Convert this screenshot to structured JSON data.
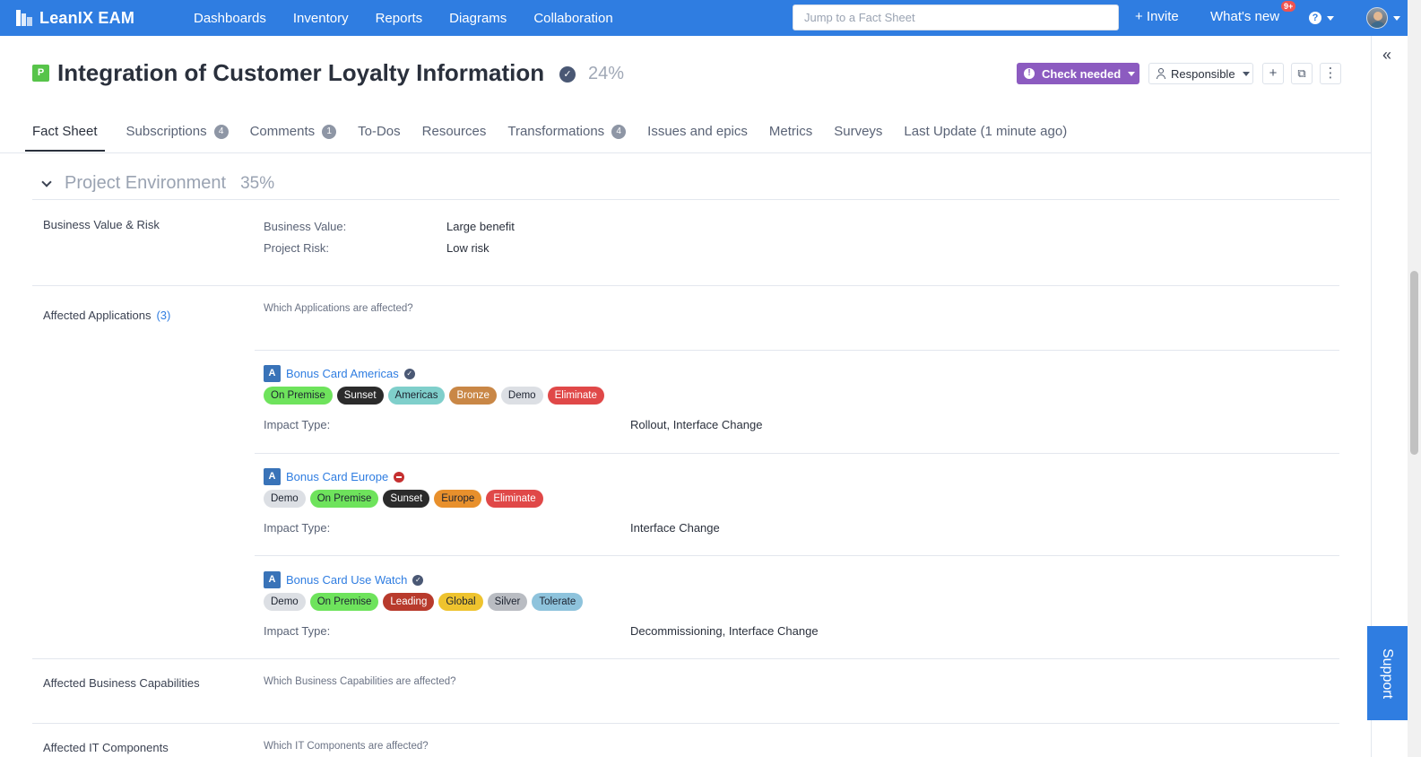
{
  "topbar": {
    "brand": "LeanIX EAM",
    "nav": [
      "Dashboards",
      "Inventory",
      "Reports",
      "Diagrams",
      "Collaboration"
    ],
    "search_placeholder": "Jump to a Fact Sheet",
    "invite": "+ Invite",
    "whats_new": "What's new",
    "whats_new_badge": "9+",
    "help": "?"
  },
  "header": {
    "type_letter": "P",
    "title": "Integration of Customer Loyalty Information",
    "completion": "24%",
    "check_needed": "Check needed",
    "responsible": "Responsible",
    "add": "+",
    "copy": "⧉",
    "more": "⋮"
  },
  "tabs": [
    {
      "label": "Fact Sheet",
      "count": ""
    },
    {
      "label": "Subscriptions",
      "count": "4"
    },
    {
      "label": "Comments",
      "count": "1"
    },
    {
      "label": "To-Dos",
      "count": ""
    },
    {
      "label": "Resources",
      "count": ""
    },
    {
      "label": "Transformations",
      "count": "4"
    },
    {
      "label": "Issues and epics",
      "count": ""
    },
    {
      "label": "Metrics",
      "count": ""
    },
    {
      "label": "Surveys",
      "count": ""
    },
    {
      "label": "Last Update (1 minute ago)",
      "count": ""
    }
  ],
  "section": {
    "title": "Project Environment",
    "completion": "35%",
    "business_value_risk": {
      "label": "Business Value & Risk",
      "business_value_label": "Business Value:",
      "business_value": "Large benefit",
      "project_risk_label": "Project Risk:",
      "project_risk": "Low risk"
    },
    "affected_apps": {
      "label": "Affected Applications",
      "count": "(3)",
      "question": "Which Applications are affected?",
      "impact_label": "Impact Type:",
      "items": [
        {
          "type": "A",
          "name": "Bonus Card Americas",
          "status": "verified",
          "tags": [
            {
              "text": "On Premise",
              "bg": "#6ee35c",
              "fg": "#1d2330"
            },
            {
              "text": "Sunset",
              "bg": "#2b2b2b",
              "fg": "#ffffff"
            },
            {
              "text": "Americas",
              "bg": "#7fcfcb",
              "fg": "#1d2330"
            },
            {
              "text": "Bronze",
              "bg": "#c98746",
              "fg": "#ffffff"
            },
            {
              "text": "Demo",
              "bg": "#dcdfe4",
              "fg": "#1d2330"
            },
            {
              "text": "Eliminate",
              "bg": "#e04848",
              "fg": "#ffffff"
            }
          ],
          "impact": "Rollout, Interface Change"
        },
        {
          "type": "A",
          "name": "Bonus Card Europe",
          "status": "blocked",
          "tags": [
            {
              "text": "Demo",
              "bg": "#dcdfe4",
              "fg": "#1d2330"
            },
            {
              "text": "On Premise",
              "bg": "#6ee35c",
              "fg": "#1d2330"
            },
            {
              "text": "Sunset",
              "bg": "#2b2b2b",
              "fg": "#ffffff"
            },
            {
              "text": "Europe",
              "bg": "#e8902c",
              "fg": "#1d2330"
            },
            {
              "text": "Eliminate",
              "bg": "#e04848",
              "fg": "#ffffff"
            }
          ],
          "impact": "Interface Change"
        },
        {
          "type": "A",
          "name": "Bonus Card Use Watch",
          "status": "verified",
          "tags": [
            {
              "text": "Demo",
              "bg": "#dcdfe4",
              "fg": "#1d2330"
            },
            {
              "text": "On Premise",
              "bg": "#6ee35c",
              "fg": "#1d2330"
            },
            {
              "text": "Leading",
              "bg": "#b83a2c",
              "fg": "#ffffff"
            },
            {
              "text": "Global",
              "bg": "#eec32e",
              "fg": "#1d2330"
            },
            {
              "text": "Silver",
              "bg": "#b9bcc2",
              "fg": "#1d2330"
            },
            {
              "text": "Tolerate",
              "bg": "#8ec3dc",
              "fg": "#1d2330"
            }
          ],
          "impact": "Decommissioning, Interface Change"
        }
      ]
    },
    "affected_caps": {
      "label": "Affected Business Capabilities",
      "question": "Which Business Capabilities are affected?"
    },
    "affected_itc": {
      "label": "Affected IT Components",
      "question": "Which IT Components are affected?"
    }
  },
  "support": "Support",
  "rail_collapse": "«",
  "colors": {
    "topbar": "#2f7de1",
    "check_needed": "#8c5bc0",
    "fs_type_project": "#57c44a",
    "app_type": "#3973b8"
  }
}
